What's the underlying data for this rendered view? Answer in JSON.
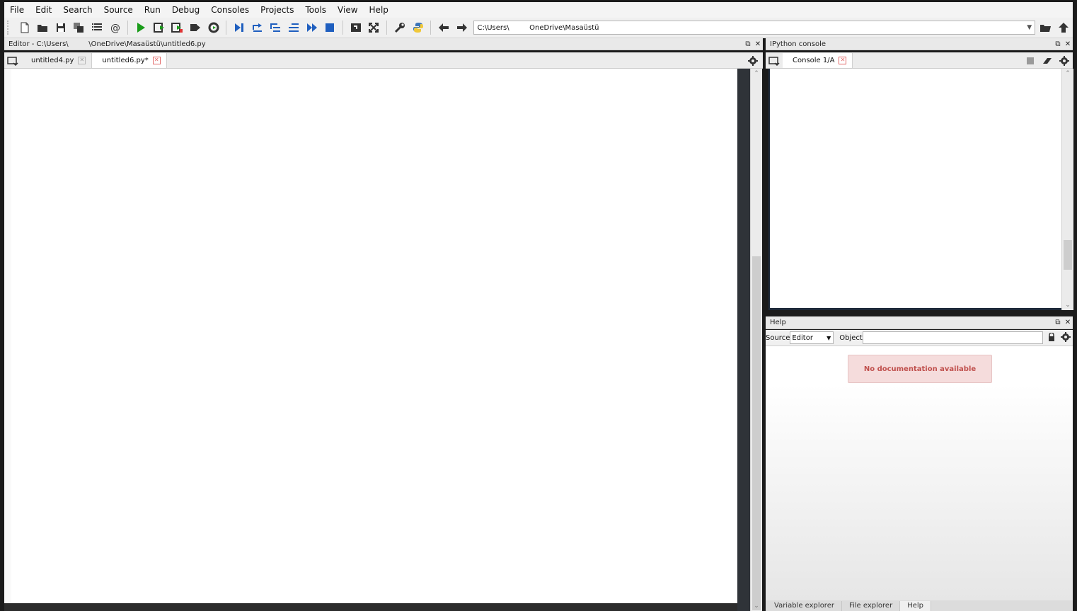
{
  "menu": [
    "File",
    "Edit",
    "Search",
    "Source",
    "Run",
    "Debug",
    "Consoles",
    "Projects",
    "Tools",
    "View",
    "Help"
  ],
  "toolbar": {
    "icons": [
      "new-file-icon",
      "open-file-icon",
      "save-icon",
      "save-all-icon",
      "outline-icon",
      "at-icon",
      "run-icon",
      "run-cell-icon",
      "run-cell-advance-icon",
      "run-selection-icon",
      "rerun-icon",
      "debug-icon",
      "step-icon",
      "step-into-icon",
      "step-return-icon",
      "continue-icon",
      "stop-debug-icon",
      "maximize-pane-icon",
      "fullscreen-icon",
      "preferences-icon",
      "python-path-icon",
      "back-icon",
      "forward-icon"
    ],
    "path_value": "C:\\Users\\         OneDrive\\Masaüstü"
  },
  "editor": {
    "title": "Editor - C:\\Users\\         \\OneDrive\\Masaüstü\\untitled6.py",
    "tabs": [
      {
        "label": "untitled4.py",
        "active": false
      },
      {
        "label": "untitled6.py*",
        "active": true
      }
    ]
  },
  "console": {
    "title": "IPython console",
    "tab": "Console 1/A"
  },
  "help": {
    "title": "Help",
    "source_label": "Source",
    "source_value": "Editor",
    "object_label": "Object",
    "object_value": "",
    "message": "No documentation available"
  },
  "bottom_tabs": [
    {
      "label": "Variable explorer",
      "active": false
    },
    {
      "label": "File explorer",
      "active": false
    },
    {
      "label": "Help",
      "active": true
    }
  ],
  "colors": {
    "accent_green": "#1a9c1a",
    "accent_blue": "#1f5fbf",
    "nodoc_text": "#c0504d",
    "nodoc_bg": "#f5dcdc"
  }
}
